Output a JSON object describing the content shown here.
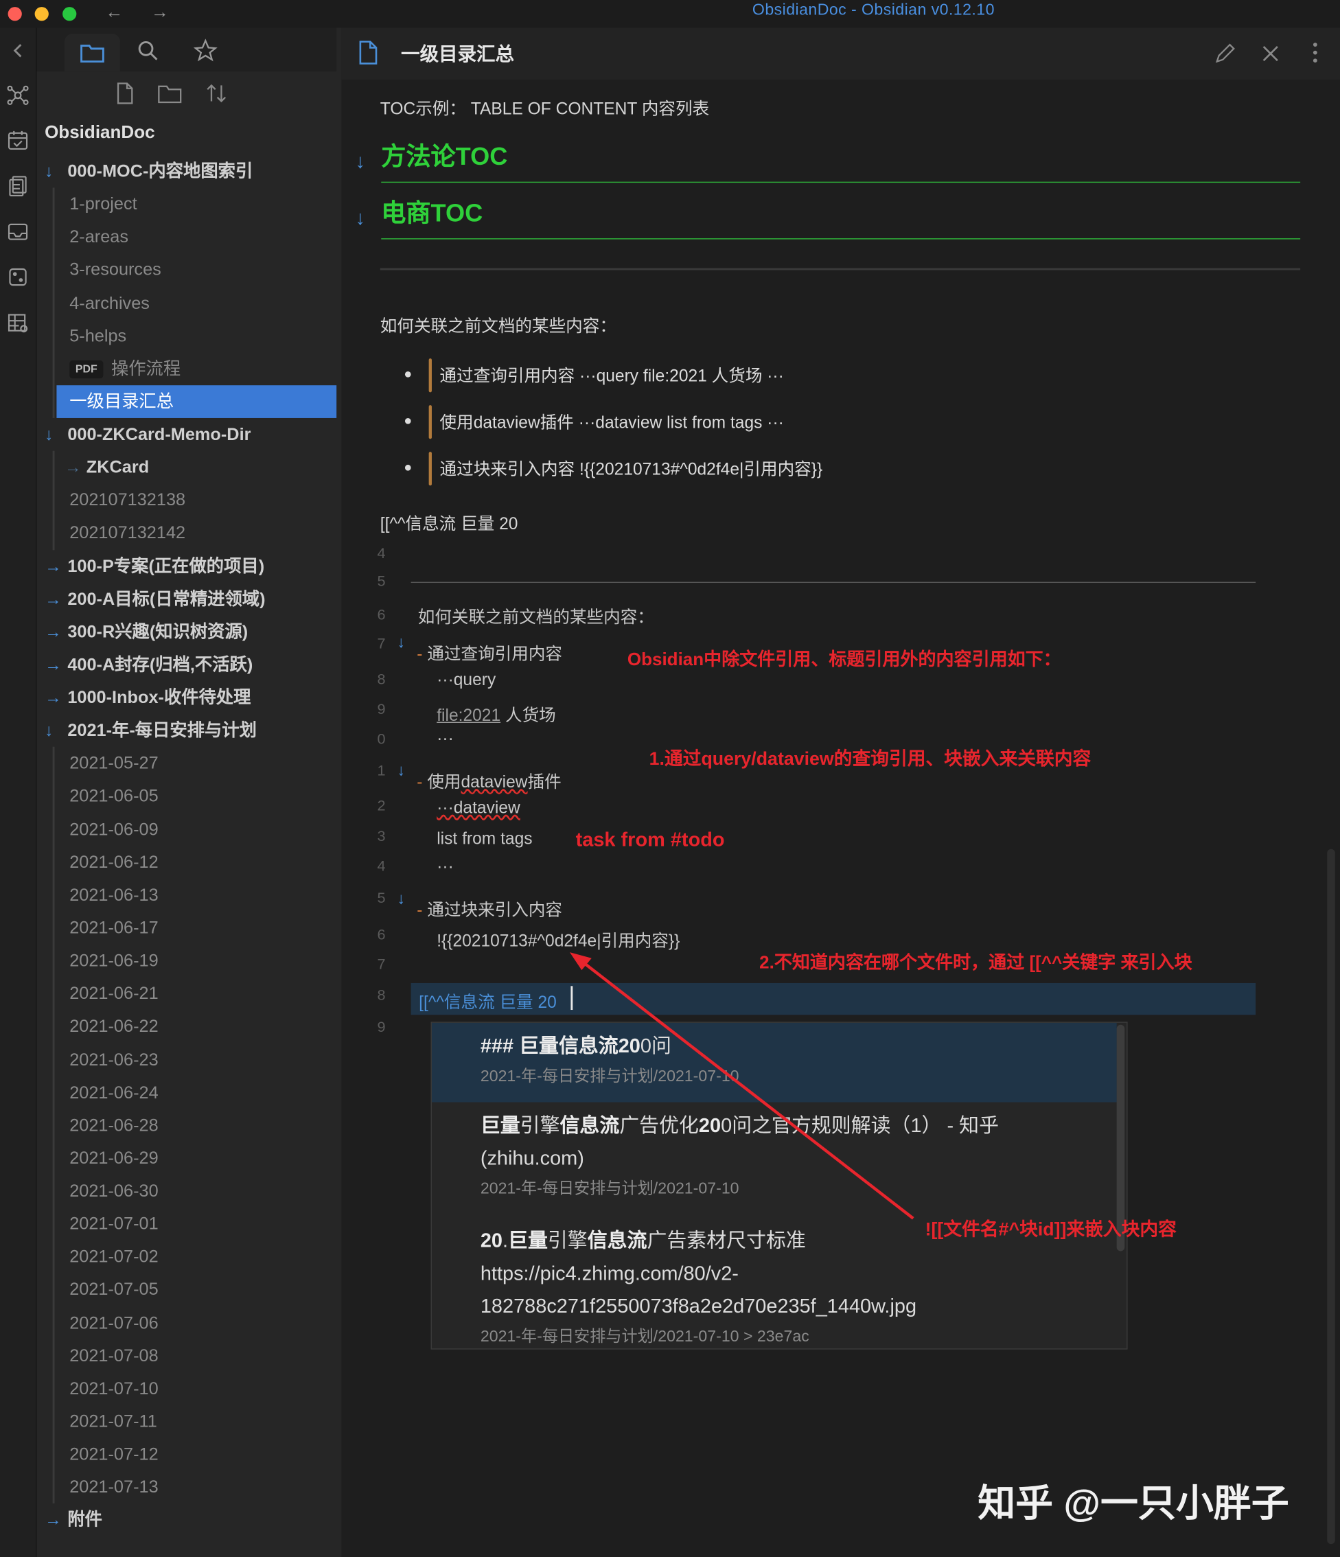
{
  "window": {
    "title": "ObsidianDoc - Obsidian v0.12.10",
    "back": "←",
    "forward": "→"
  },
  "sidebar": {
    "vault": "ObsidianDoc",
    "tree": [
      {
        "label": "000-MOC-内容地图索引",
        "kind": "folder-open"
      },
      {
        "label": "1-project",
        "kind": "file"
      },
      {
        "label": "2-areas",
        "kind": "file"
      },
      {
        "label": "3-resources",
        "kind": "file"
      },
      {
        "label": "4-archives",
        "kind": "file"
      },
      {
        "label": "5-helps",
        "kind": "file"
      },
      {
        "label": "操作流程",
        "kind": "pdf",
        "badge": "PDF"
      },
      {
        "label": "一级目录汇总",
        "kind": "file-active"
      },
      {
        "label": "000-ZKCard-Memo-Dir",
        "kind": "folder-open"
      },
      {
        "label": "ZKCard",
        "kind": "subfolder"
      },
      {
        "label": "202107132138",
        "kind": "file"
      },
      {
        "label": "202107132142",
        "kind": "file"
      },
      {
        "label": "100-P专案(正在做的项目)",
        "kind": "folder"
      },
      {
        "label": "200-A目标(日常精进领域)",
        "kind": "folder"
      },
      {
        "label": "300-R兴趣(知识树资源)",
        "kind": "folder"
      },
      {
        "label": "400-A封存(归档,不活跃)",
        "kind": "folder"
      },
      {
        "label": "1000-Inbox-收件待处理",
        "kind": "folder"
      },
      {
        "label": "2021-年-每日安排与计划",
        "kind": "folder-open"
      },
      {
        "label": "2021-05-27",
        "kind": "file"
      },
      {
        "label": "2021-06-05",
        "kind": "file"
      },
      {
        "label": "2021-06-09",
        "kind": "file"
      },
      {
        "label": "2021-06-12",
        "kind": "file"
      },
      {
        "label": "2021-06-13",
        "kind": "file"
      },
      {
        "label": "2021-06-17",
        "kind": "file"
      },
      {
        "label": "2021-06-19",
        "kind": "file"
      },
      {
        "label": "2021-06-21",
        "kind": "file"
      },
      {
        "label": "2021-06-22",
        "kind": "file"
      },
      {
        "label": "2021-06-23",
        "kind": "file"
      },
      {
        "label": "2021-06-24",
        "kind": "file"
      },
      {
        "label": "2021-06-28",
        "kind": "file"
      },
      {
        "label": "2021-06-29",
        "kind": "file"
      },
      {
        "label": "2021-06-30",
        "kind": "file"
      },
      {
        "label": "2021-07-01",
        "kind": "file"
      },
      {
        "label": "2021-07-02",
        "kind": "file"
      },
      {
        "label": "2021-07-05",
        "kind": "file"
      },
      {
        "label": "2021-07-06",
        "kind": "file"
      },
      {
        "label": "2021-07-08",
        "kind": "file"
      },
      {
        "label": "2021-07-10",
        "kind": "file"
      },
      {
        "label": "2021-07-11",
        "kind": "file"
      },
      {
        "label": "2021-07-12",
        "kind": "file"
      },
      {
        "label": "2021-07-13",
        "kind": "file"
      },
      {
        "label": "附件",
        "kind": "folder"
      }
    ]
  },
  "doc": {
    "title": "一级目录汇总",
    "toc_line": "TOC示例： TABLE OF CONTENT 内容列表",
    "heading1": "方法论TOC",
    "heading2": "电商TOC",
    "question": "如何关联之前文档的某些内容：",
    "bullets": [
      "通过查询引用内容 ···query file:2021 人货场 ···",
      "使用dataview插件 ···dataview list from tags ···",
      "通过块来引入内容 !{{20210713#^0d2f4e|引用内容}}"
    ],
    "link_line": "[[^^信息流 巨量 20"
  },
  "editor": {
    "line_numbers": [
      "4",
      "5",
      "6",
      "7",
      "8",
      "9",
      "0",
      "1",
      "2",
      "3",
      "4",
      "5",
      "6",
      "7",
      "8",
      "9"
    ],
    "question": "如何关联之前文档的某些内容：",
    "dash": "-",
    "item1": "通过查询引用内容",
    "query": "···query",
    "file_ref": "file:2021",
    "renhuo": " 人货场",
    "dots": "···",
    "item2_pre": "使用",
    "item2_dv": "dataview",
    "item2_post": "插件",
    "dataview": "···dataview",
    "list_tags": "list from tags",
    "item3": "通过块来引入内容",
    "embed": "!{{20210713#^0d2f4e|引用内容}}",
    "active_line": "[[^^信息流 巨量 20"
  },
  "annotations": {
    "a1": "Obsidian中除文件引用、标题引用外的内容引用如下：",
    "a2": "1.通过query/dataview的查询引用、块嵌入来关联内容",
    "a3": "task from #todo",
    "a4": "2.不知道内容在哪个文件时，通过 [[^^关键字 来引入块",
    "a5": "![[文件名#^块id]]来嵌入块内容",
    "color": "#e8252d"
  },
  "suggestions": [
    {
      "pre": "### ",
      "b1": "巨量信息流20",
      "post": "0问",
      "path": "2021-年-每日安排与计划/2021-07-10"
    },
    {
      "b1": "巨量",
      "mid1": "引擎",
      "b2": "信息流",
      "mid2": "广告优化",
      "b3": "20",
      "post": "0问之官方规则解读（1） - 知乎",
      "line2": "(zhihu.com)",
      "path": "2021-年-每日安排与计划/2021-07-10"
    },
    {
      "b1": "20",
      "mid1": ".",
      "b2": "巨量",
      "mid2": "引擎",
      "b3": "信息流",
      "post": "广告素材尺寸标准",
      "line2": "https://pic4.zhimg.com/80/v2-",
      "line3": "182788c271f2550073f8a2e2d70e235f_1440w.jpg",
      "path": "2021-年-每日安排与计划/2021-07-10 > 23e7ac"
    }
  ],
  "watermark": "知乎 @一只小胖子"
}
